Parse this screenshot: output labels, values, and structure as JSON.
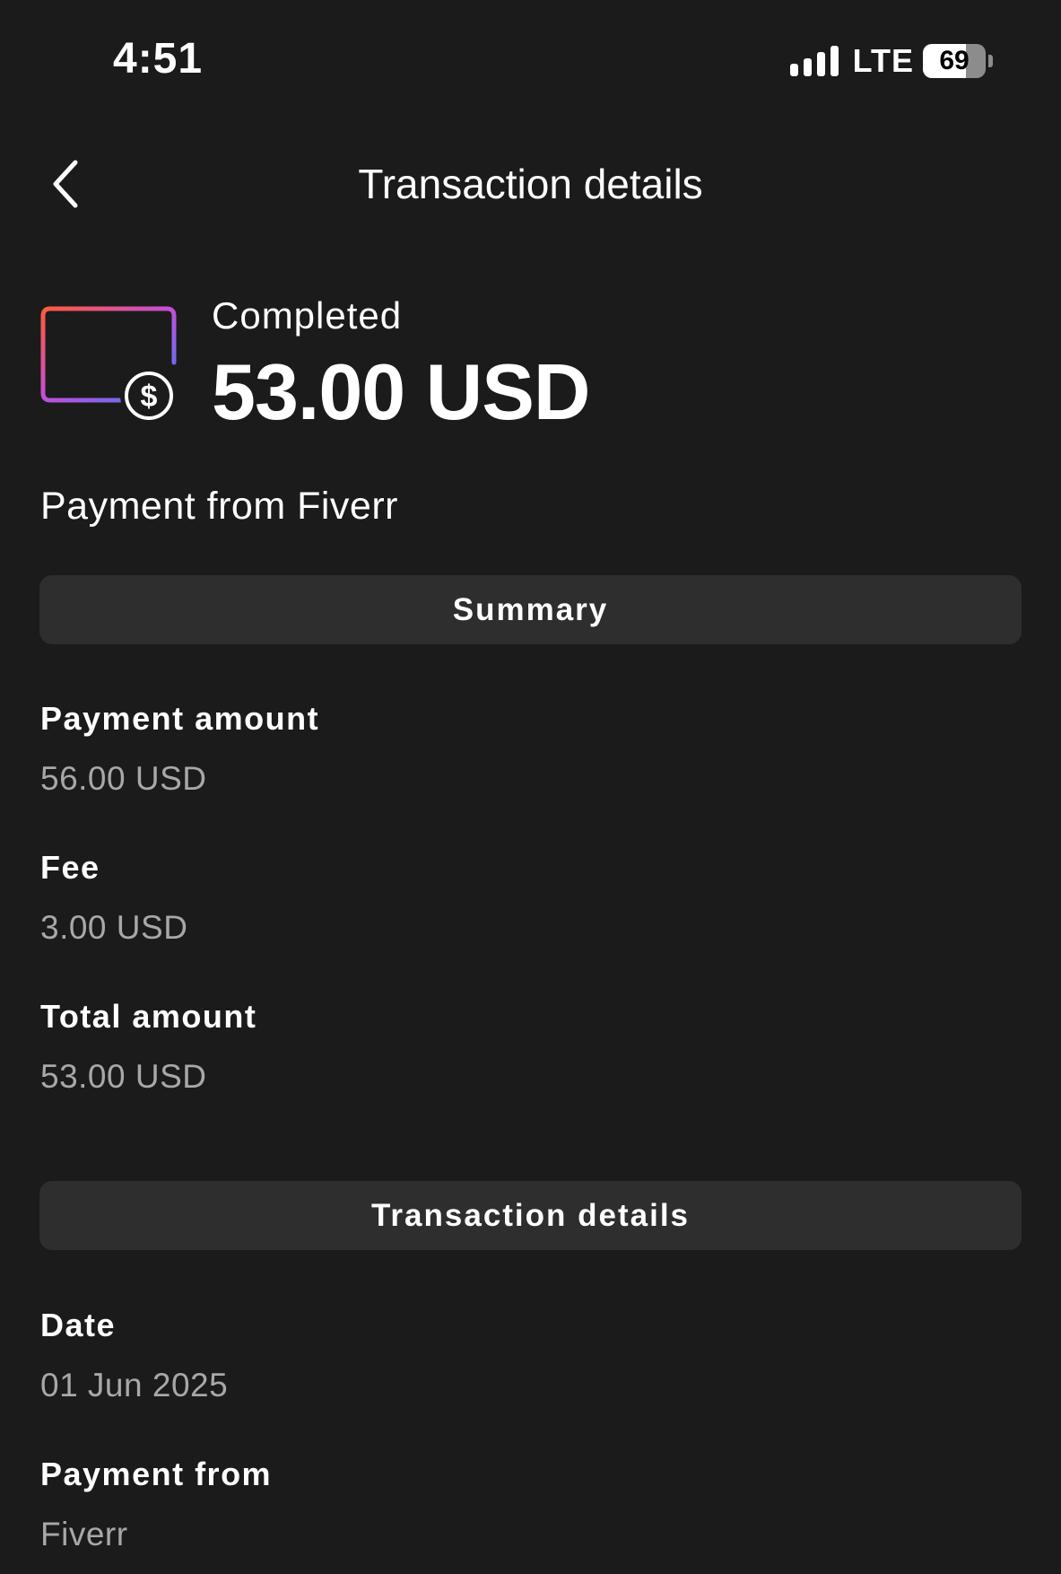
{
  "status_bar": {
    "time": "4:51",
    "network": "LTE",
    "battery_percent": "69",
    "battery_level": 0.69,
    "signal_bars": 4
  },
  "nav": {
    "back_icon": "chevron-left-icon",
    "title": "Transaction details"
  },
  "hero": {
    "icon": "card-dollar-icon",
    "status": "Completed",
    "amount": "53.00 USD",
    "subtitle": "Payment from Fiverr"
  },
  "summary": {
    "header": "Summary",
    "fields": [
      {
        "label": "Payment amount",
        "value": "56.00 USD"
      },
      {
        "label": "Fee",
        "value": "3.00 USD"
      },
      {
        "label": "Total amount",
        "value": "53.00 USD"
      }
    ]
  },
  "details": {
    "header": "Transaction details",
    "fields": [
      {
        "label": "Date",
        "value": "01 Jun 2025"
      },
      {
        "label": "Payment from",
        "value": "Fiverr"
      }
    ]
  },
  "colors": {
    "background": "#1b1b1b",
    "section_header_bg": "#2e2e2f",
    "muted_text": "#a8a8a8",
    "icon_gradient_start": "#ff5a3c",
    "icon_gradient_mid": "#c24fd8",
    "icon_gradient_end": "#3c7cff"
  }
}
